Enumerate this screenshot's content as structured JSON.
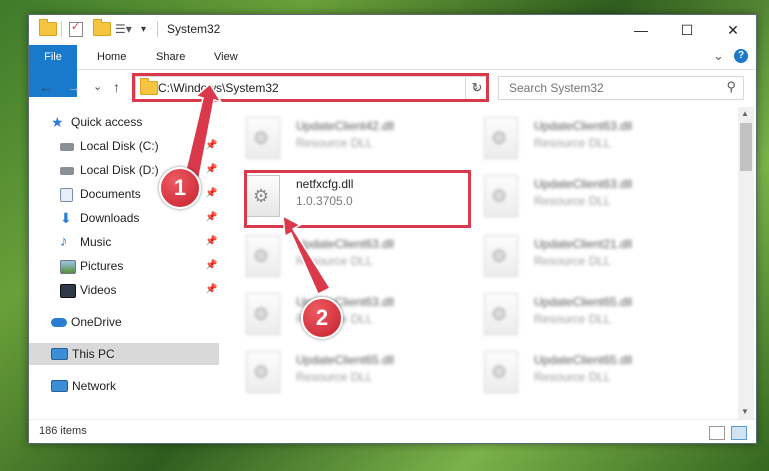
{
  "window": {
    "title": "System32"
  },
  "window_controls": {
    "minimize": "—",
    "maximize": "☐",
    "close": "✕"
  },
  "ribbon": {
    "tabs": [
      "File",
      "Home",
      "Share",
      "View"
    ],
    "expand": "⌄",
    "help": "?"
  },
  "address_bar": {
    "path": "C:\\Windows\\System32",
    "dropdown": "⌄",
    "refresh": "↻"
  },
  "search": {
    "placeholder": "Search System32",
    "icon": "⚲"
  },
  "nav_buttons": {
    "back": "←",
    "forward": "→",
    "recent": "⌄",
    "up": "↑"
  },
  "nav_pane": {
    "items": [
      {
        "label": "Quick access",
        "icon": "star-icon",
        "pinned": false
      },
      {
        "label": "Local Disk (C:)",
        "icon": "drive-icon",
        "pinned": true
      },
      {
        "label": "Local Disk (D:)",
        "icon": "drive-icon",
        "pinned": true
      },
      {
        "label": "Documents",
        "icon": "documents-icon",
        "pinned": true
      },
      {
        "label": "Downloads",
        "icon": "downloads-icon",
        "pinned": true
      },
      {
        "label": "Music",
        "icon": "music-icon",
        "pinned": true
      },
      {
        "label": "Pictures",
        "icon": "pictures-icon",
        "pinned": true
      },
      {
        "label": "Videos",
        "icon": "videos-icon",
        "pinned": true
      },
      {
        "label": "OneDrive",
        "icon": "cloud-icon",
        "pinned": false
      },
      {
        "label": "This PC",
        "icon": "computer-icon",
        "pinned": false,
        "selected": true
      },
      {
        "label": "Network",
        "icon": "network-icon",
        "pinned": false
      }
    ],
    "pin_glyph": "📌"
  },
  "files": {
    "highlighted": {
      "name": "netfxcfg.dll",
      "detail": "1.0.3705.0"
    },
    "left_column": [
      {
        "name": "UpdateClient42.dll",
        "detail": "Resource DLL"
      },
      {
        "name": "UpdateClient63.dll",
        "detail": "Resource DLL"
      },
      {
        "name": "UpdateClient63.dll",
        "detail": "Resource DLL"
      },
      {
        "name": "UpdateClient65.dll",
        "detail": "Resource DLL"
      }
    ],
    "right_column": [
      {
        "name": "UpdateClient63.dll",
        "detail": "Resource DLL"
      },
      {
        "name": "UpdateClient63.dll",
        "detail": "Resource DLL"
      },
      {
        "name": "UpdateClient21.dll",
        "detail": "Resource DLL"
      },
      {
        "name": "UpdateClient65.dll",
        "detail": "Resource DLL"
      },
      {
        "name": "UpdateClient65.dll",
        "detail": "Resource DLL"
      }
    ]
  },
  "status_bar": {
    "item_count": "186 items"
  },
  "callouts": [
    "1",
    "2"
  ],
  "colors": {
    "accent": "#1979ca",
    "highlight": "#d9394a"
  }
}
